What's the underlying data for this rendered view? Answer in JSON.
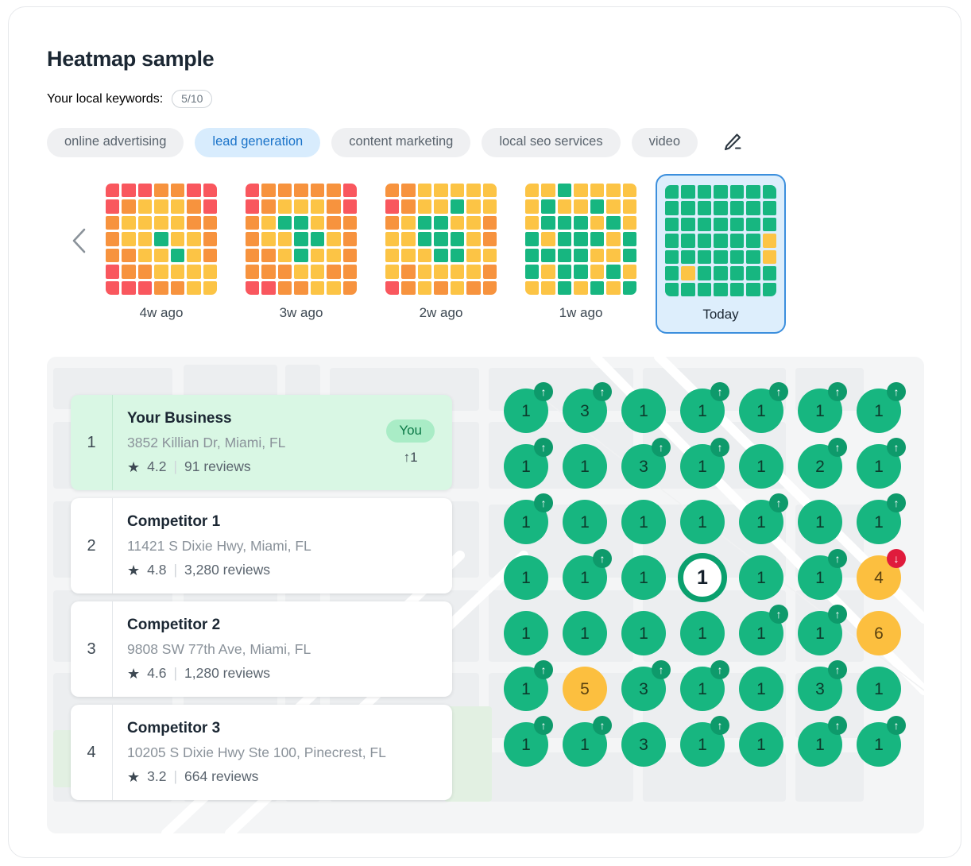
{
  "header": {
    "title": "Heatmap sample",
    "keywords_label": "Your local keywords:",
    "keywords_count": "5/10",
    "edit_icon": "pencil-icon"
  },
  "keywords": [
    {
      "label": "online advertising",
      "active": false
    },
    {
      "label": "lead generation",
      "active": true
    },
    {
      "label": "content marketing",
      "active": false
    },
    {
      "label": "local seo services",
      "active": false
    },
    {
      "label": "video",
      "active": false
    }
  ],
  "timeline": {
    "prev_icon": "chevron-left-icon",
    "snapshots": [
      {
        "label": "4w ago",
        "selected": false,
        "cells": [
          "r",
          "r",
          "r",
          "o",
          "o",
          "r",
          "r",
          "r",
          "o",
          "y",
          "y",
          "y",
          "o",
          "r",
          "o",
          "y",
          "y",
          "y",
          "y",
          "o",
          "o",
          "o",
          "y",
          "y",
          "g",
          "y",
          "y",
          "o",
          "o",
          "o",
          "y",
          "y",
          "g",
          "y",
          "o",
          "r",
          "o",
          "o",
          "y",
          "y",
          "y",
          "y",
          "r",
          "r",
          "r",
          "o",
          "o",
          "y",
          "y"
        ]
      },
      {
        "label": "3w ago",
        "selected": false,
        "cells": [
          "r",
          "o",
          "o",
          "o",
          "o",
          "o",
          "r",
          "r",
          "o",
          "y",
          "y",
          "y",
          "o",
          "r",
          "o",
          "y",
          "g",
          "g",
          "y",
          "o",
          "o",
          "o",
          "y",
          "y",
          "g",
          "g",
          "y",
          "o",
          "o",
          "o",
          "y",
          "g",
          "y",
          "y",
          "o",
          "o",
          "o",
          "o",
          "y",
          "y",
          "o",
          "o",
          "r",
          "r",
          "o",
          "o",
          "y",
          "y",
          "o"
        ]
      },
      {
        "label": "2w ago",
        "selected": false,
        "cells": [
          "o",
          "o",
          "y",
          "y",
          "y",
          "y",
          "y",
          "r",
          "o",
          "y",
          "y",
          "g",
          "y",
          "y",
          "o",
          "y",
          "g",
          "g",
          "y",
          "y",
          "o",
          "y",
          "y",
          "g",
          "g",
          "g",
          "y",
          "o",
          "y",
          "y",
          "y",
          "g",
          "g",
          "y",
          "y",
          "y",
          "o",
          "y",
          "y",
          "y",
          "y",
          "o",
          "r",
          "o",
          "y",
          "o",
          "y",
          "o",
          "o"
        ]
      },
      {
        "label": "1w ago",
        "selected": false,
        "cells": [
          "y",
          "y",
          "g",
          "y",
          "y",
          "y",
          "y",
          "y",
          "g",
          "y",
          "y",
          "g",
          "y",
          "y",
          "y",
          "g",
          "g",
          "g",
          "y",
          "g",
          "y",
          "g",
          "y",
          "g",
          "g",
          "g",
          "y",
          "g",
          "g",
          "g",
          "g",
          "g",
          "y",
          "y",
          "g",
          "g",
          "y",
          "g",
          "g",
          "y",
          "g",
          "y",
          "y",
          "y",
          "g",
          "y",
          "g",
          "y",
          "g"
        ]
      },
      {
        "label": "Today",
        "selected": true,
        "cells": [
          "g",
          "g",
          "g",
          "g",
          "g",
          "g",
          "g",
          "g",
          "g",
          "g",
          "g",
          "g",
          "g",
          "g",
          "g",
          "g",
          "g",
          "g",
          "g",
          "g",
          "g",
          "g",
          "g",
          "g",
          "g",
          "g",
          "g",
          "y",
          "g",
          "g",
          "g",
          "g",
          "g",
          "g",
          "y",
          "g",
          "y",
          "g",
          "g",
          "g",
          "g",
          "g",
          "g",
          "g",
          "g",
          "g",
          "g",
          "g",
          "g"
        ]
      }
    ]
  },
  "rankings": [
    {
      "rank": "1",
      "name": "Your Business",
      "address": "3852 Killian Dr, Miami, FL",
      "rating": "4.2",
      "reviews": "91 reviews",
      "is_you": true,
      "badge": "You",
      "delta": "↑1"
    },
    {
      "rank": "2",
      "name": "Competitor 1",
      "address": "11421 S Dixie Hwy, Miami, FL",
      "rating": "4.8",
      "reviews": "3,280 reviews",
      "is_you": false,
      "badge": "",
      "delta": ""
    },
    {
      "rank": "3",
      "name": "Competitor 2",
      "address": "9808 SW 77th Ave, Miami, FL",
      "rating": "4.6",
      "reviews": "1,280 reviews",
      "is_you": false,
      "badge": "",
      "delta": ""
    },
    {
      "rank": "4",
      "name": "Competitor 3",
      "address": "10205 S Dixie Hwy Ste 100, Pinecrest, FL",
      "rating": "3.2",
      "reviews": "664 reviews",
      "is_you": false,
      "badge": "",
      "delta": ""
    }
  ],
  "map": {
    "pin_rows": [
      [
        {
          "value": "1",
          "color": "green",
          "trend": "up"
        },
        {
          "value": "3",
          "color": "green",
          "trend": "up"
        },
        {
          "value": "1",
          "color": "green",
          "trend": "none"
        },
        {
          "value": "1",
          "color": "green",
          "trend": "up"
        },
        {
          "value": "1",
          "color": "green",
          "trend": "up"
        },
        {
          "value": "1",
          "color": "green",
          "trend": "up"
        },
        {
          "value": "1",
          "color": "green",
          "trend": "up"
        }
      ],
      [
        {
          "value": "1",
          "color": "green",
          "trend": "up"
        },
        {
          "value": "1",
          "color": "green",
          "trend": "none"
        },
        {
          "value": "3",
          "color": "green",
          "trend": "up"
        },
        {
          "value": "1",
          "color": "green",
          "trend": "up"
        },
        {
          "value": "1",
          "color": "green",
          "trend": "none"
        },
        {
          "value": "2",
          "color": "green",
          "trend": "up"
        },
        {
          "value": "1",
          "color": "green",
          "trend": "up"
        }
      ],
      [
        {
          "value": "1",
          "color": "green",
          "trend": "up"
        },
        {
          "value": "1",
          "color": "green",
          "trend": "none"
        },
        {
          "value": "1",
          "color": "green",
          "trend": "none"
        },
        {
          "value": "1",
          "color": "green",
          "trend": "none"
        },
        {
          "value": "1",
          "color": "green",
          "trend": "up"
        },
        {
          "value": "1",
          "color": "green",
          "trend": "none"
        },
        {
          "value": "1",
          "color": "green",
          "trend": "up"
        }
      ],
      [
        {
          "value": "1",
          "color": "green",
          "trend": "none"
        },
        {
          "value": "1",
          "color": "green",
          "trend": "up"
        },
        {
          "value": "1",
          "color": "green",
          "trend": "none"
        },
        {
          "value": "1",
          "color": "center",
          "trend": "none"
        },
        {
          "value": "1",
          "color": "green",
          "trend": "none"
        },
        {
          "value": "1",
          "color": "green",
          "trend": "up"
        },
        {
          "value": "4",
          "color": "orange",
          "trend": "down"
        }
      ],
      [
        {
          "value": "1",
          "color": "green",
          "trend": "none"
        },
        {
          "value": "1",
          "color": "green",
          "trend": "none"
        },
        {
          "value": "1",
          "color": "green",
          "trend": "none"
        },
        {
          "value": "1",
          "color": "green",
          "trend": "none"
        },
        {
          "value": "1",
          "color": "green",
          "trend": "up"
        },
        {
          "value": "1",
          "color": "green",
          "trend": "up"
        },
        {
          "value": "6",
          "color": "orange",
          "trend": "none"
        }
      ],
      [
        {
          "value": "1",
          "color": "green",
          "trend": "up"
        },
        {
          "value": "5",
          "color": "orange",
          "trend": "none"
        },
        {
          "value": "3",
          "color": "green",
          "trend": "up"
        },
        {
          "value": "1",
          "color": "green",
          "trend": "up"
        },
        {
          "value": "1",
          "color": "green",
          "trend": "none"
        },
        {
          "value": "3",
          "color": "green",
          "trend": "up"
        },
        {
          "value": "1",
          "color": "green",
          "trend": "none"
        }
      ],
      [
        {
          "value": "1",
          "color": "green",
          "trend": "up"
        },
        {
          "value": "1",
          "color": "green",
          "trend": "up"
        },
        {
          "value": "3",
          "color": "green",
          "trend": "none"
        },
        {
          "value": "1",
          "color": "green",
          "trend": "up"
        },
        {
          "value": "1",
          "color": "green",
          "trend": "none"
        },
        {
          "value": "1",
          "color": "green",
          "trend": "up"
        },
        {
          "value": "1",
          "color": "green",
          "trend": "up"
        }
      ]
    ]
  },
  "colors": {
    "green": "#17b680",
    "yellow": "#fcc445",
    "orange": "#f7933e",
    "red": "#f9575e",
    "accent_blue": "#3c8fdd",
    "you_bg": "#d9f7e4",
    "down_red": "#e01b3c"
  }
}
